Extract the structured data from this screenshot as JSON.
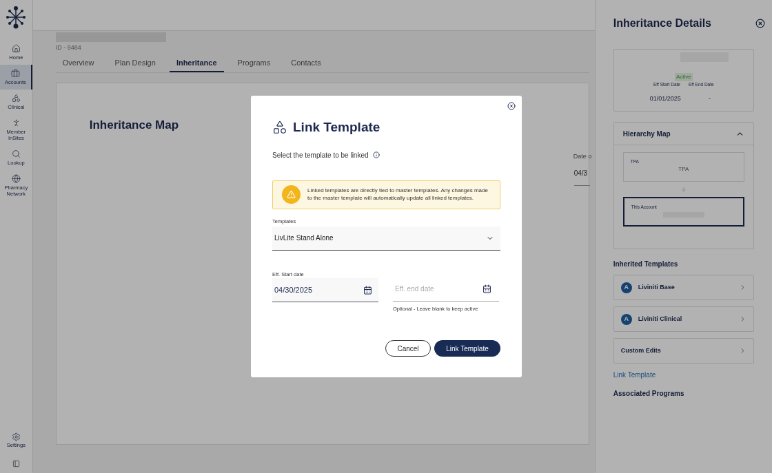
{
  "sidebar": {
    "items": [
      {
        "label": "Home",
        "selected": false
      },
      {
        "label": "Accounts",
        "selected": true
      },
      {
        "label": "Clinical",
        "selected": false
      },
      {
        "label": "Member InSites",
        "selected": false
      },
      {
        "label": "Lookup",
        "selected": false
      },
      {
        "label": "Pharmacy Network",
        "selected": false
      }
    ],
    "footer": [
      {
        "label": "Settings"
      }
    ]
  },
  "account": {
    "id": "ID - 9484"
  },
  "tabs": [
    {
      "label": "Overview",
      "selected": false
    },
    {
      "label": "Plan Design",
      "selected": false
    },
    {
      "label": "Inheritance",
      "selected": true
    },
    {
      "label": "Programs",
      "selected": false
    },
    {
      "label": "Contacts",
      "selected": false
    }
  ],
  "main": {
    "title": "Inheritance Map",
    "column_label": "Date o",
    "column_value": "04/3"
  },
  "modal": {
    "title": "Link Template",
    "subtitle": "Select the template to be linked",
    "warning": "Linked templates are directly tied to master templates. Any changes made to the master template will automatically update all linked templates.",
    "templates_label": "Templates",
    "templates_value": "LivLite Stand Alone",
    "start_label": "Eff. Start date",
    "start_value": "04/30/2025",
    "end_placeholder": "Eff. end date",
    "end_hint": "Optional - Leave blank to keep active",
    "cancel": "Cancel",
    "submit": "Link Template"
  },
  "panel": {
    "title": "Inheritance Details",
    "status": "Active",
    "start_label": "Eff Start Date",
    "end_label": "Eff End Date",
    "start_value": "01/01/2025",
    "end_value": "-",
    "hierarchy_title": "Hierarchy Map",
    "hierarchy_expanded": true,
    "nodes": [
      {
        "label": "TPA",
        "value": "TPA",
        "selected": false
      },
      {
        "label": "This Account",
        "selected": true
      }
    ],
    "inherited_title": "Inherited Templates",
    "templates": [
      {
        "name": "Liviniti Base",
        "badge": "A"
      },
      {
        "name": "Liviniti Clinical",
        "badge": "A"
      },
      {
        "name": "Custom Edits"
      }
    ],
    "link": "Link Template",
    "associated_title": "Associated Programs"
  }
}
